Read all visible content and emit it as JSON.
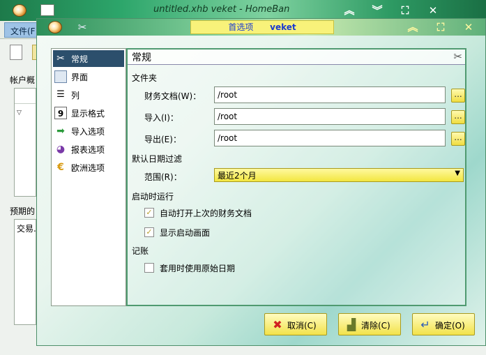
{
  "main_window": {
    "title": "untitled.xhb veket - HomeBan",
    "menu_file": "文件(F",
    "accounts_label": "帐户概",
    "predicted_label": "预期的",
    "predicted_col": "交易."
  },
  "dialog": {
    "title": "首选项",
    "app_name": "veket",
    "sidebar": {
      "items": [
        {
          "label": "常规",
          "icon": "wrench-icon"
        },
        {
          "label": "界面",
          "icon": "window-icon"
        },
        {
          "label": "列",
          "icon": "columns-icon"
        },
        {
          "label": "显示格式",
          "icon": "calendar-icon"
        },
        {
          "label": "导入选项",
          "icon": "import-icon"
        },
        {
          "label": "报表选项",
          "icon": "chart-icon"
        },
        {
          "label": "欧洲选项",
          "icon": "euro-icon"
        }
      ]
    },
    "panel": {
      "title": "常规",
      "files_section": "文件夹",
      "wallet_label": "财务文档(W)：",
      "wallet_value": "/root",
      "import_label": "导入(I)：",
      "import_value": "/root",
      "export_label": "导出(E)：",
      "export_value": "/root",
      "date_filter_section": "默认日期过滤",
      "range_label": "范围(R)：",
      "range_value": "最近2个月",
      "startup_section": "启动时运行",
      "open_last_label": "自动打开上次的财务文档",
      "open_last_checked": true,
      "show_splash_label": "显示启动画面",
      "show_splash_checked": true,
      "bookkeeping_section": "记账",
      "original_date_label": "套用时使用原始日期",
      "original_date_checked": false,
      "browse_label": "..."
    },
    "buttons": {
      "cancel": "取消(C)",
      "clear": "清除(C)",
      "ok": "确定(O)"
    }
  },
  "colors": {
    "accent_yellow": "#f2e24a",
    "selection": "#2c4f6c",
    "title_text": "#1a3ad0"
  }
}
